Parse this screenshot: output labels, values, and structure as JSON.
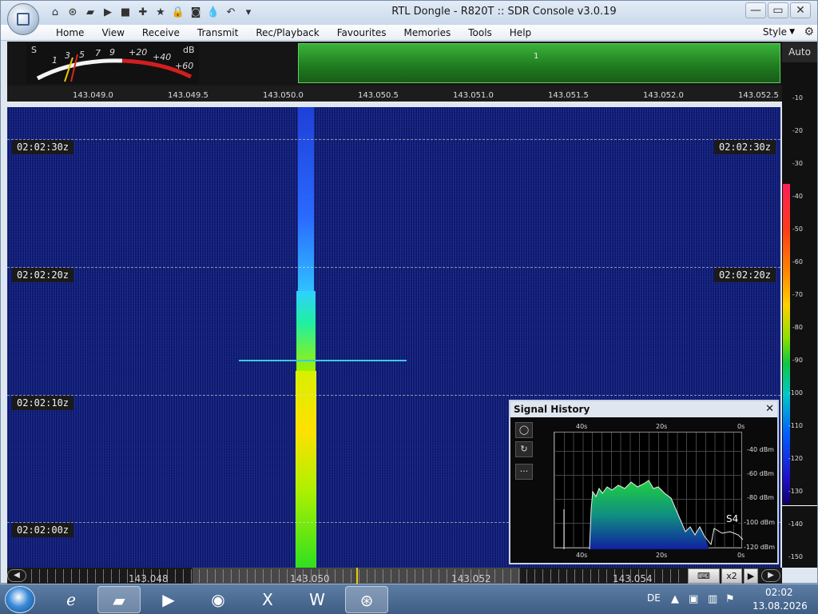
{
  "window": {
    "title": "RTL Dongle - R820T :: SDR Console v3.0.19",
    "min_glyph": "—",
    "max_glyph": "▭",
    "close_glyph": "✕"
  },
  "quick_access_icons": [
    "home-icon",
    "help-ring-icon",
    "folder-icon",
    "play-icon",
    "stop-icon",
    "plus-icon",
    "star-icon",
    "lock-icon",
    "camera-icon",
    "drop-icon",
    "undo-icon",
    "dropdown-icon"
  ],
  "menu": {
    "items": [
      "Home",
      "View",
      "Receive",
      "Transmit",
      "Rec/Playback",
      "Favourites",
      "Memories",
      "Tools",
      "Help"
    ],
    "style_label": "Style"
  },
  "smeter": {
    "labels": [
      "S",
      "1",
      "3",
      "5",
      "7",
      "9",
      "+20",
      "+40",
      "+60",
      "dB"
    ]
  },
  "spectrum": {
    "marker": "1"
  },
  "frequency_scale": [
    "143.049.0",
    "143.049.5",
    "143.050.0",
    "143.050.5",
    "143.051.0",
    "143.051.5",
    "143.052.0",
    "143.052.5"
  ],
  "waterfall": {
    "times": [
      "02:02:30z",
      "02:02:20z",
      "02:02:10z",
      "02:02:00z"
    ]
  },
  "signal_history": {
    "title": "Signal History",
    "close_glyph": "✕",
    "buttons": [
      "◯",
      "↻",
      "···"
    ],
    "top_axis": [
      "40s",
      "20s",
      "0s"
    ],
    "bottom_axis": [
      "40s",
      "20s",
      "0s"
    ],
    "y_axis": [
      "-40 dBm",
      "-60 dBm",
      "-80 dBm",
      "-100 dBm",
      "-120 dBm"
    ],
    "s_reading": "S4"
  },
  "colorbar": {
    "auto_label": "Auto",
    "ticks": [
      "-10",
      "-20",
      "-30",
      "-40",
      "-50",
      "-60",
      "-70",
      "-80",
      "-90",
      "-100",
      "-110",
      "-120",
      "-130",
      "-140",
      "-150"
    ]
  },
  "bottom_scale": {
    "labels": [
      "143.048",
      "143.050",
      "143.052",
      "143.054"
    ],
    "zoom_label": "x2"
  },
  "taskbar": {
    "language": "DE",
    "time": "02:02",
    "date": "13.08.2026"
  }
}
